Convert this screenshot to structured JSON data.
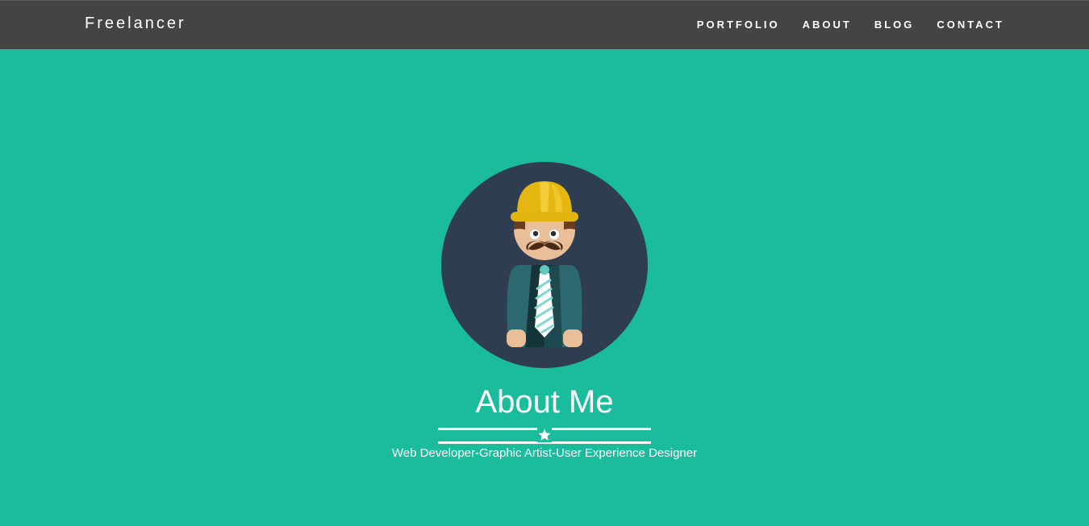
{
  "navbar": {
    "brand": "Freelancer",
    "items": [
      {
        "label": "PORTFOLIO"
      },
      {
        "label": "ABOUT"
      },
      {
        "label": "BLOG"
      },
      {
        "label": "CONTACT"
      }
    ]
  },
  "hero": {
    "avatar_icon": "construction-worker-avatar-icon",
    "title": "About Me",
    "divider_icon": "star-icon",
    "subtitle": "Web Developer-Graphic Artist-User Experience Designer"
  },
  "colors": {
    "background": "#1abc9c",
    "navbar": "#444444",
    "avatar_circle": "#2c3e50",
    "text": "#ffffff"
  }
}
